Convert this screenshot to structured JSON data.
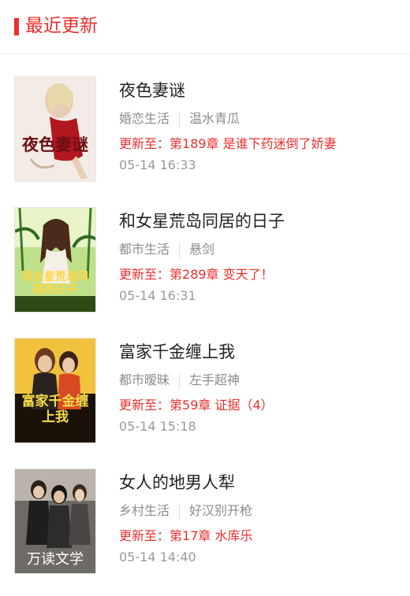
{
  "header": {
    "title": "最近更新"
  },
  "books": [
    {
      "title": "夜色妻谜",
      "category": "婚恋生活",
      "author": "温水青瓜",
      "update_prefix": "更新至：",
      "chapter": "第189章 是谁下药迷倒了娇妻",
      "time": "05-14 16:33",
      "cover_text": "夜色妻谜"
    },
    {
      "title": "和女星荒岛同居的日子",
      "category": "都市生活",
      "author": "悬剑",
      "update_prefix": "更新至：",
      "chapter": "第289章 变天了！",
      "time": "05-14 16:31",
      "cover_text": "和女星荒岛同居的日子"
    },
    {
      "title": "富家千金缠上我",
      "category": "都市暧昧",
      "author": "左手超神",
      "update_prefix": "更新至：",
      "chapter": "第59章 证据（4）",
      "time": "05-14 15:18",
      "cover_text": "富家千金缠上我"
    },
    {
      "title": "女人的地男人犁",
      "category": "乡村生活",
      "author": "好汉别开枪",
      "update_prefix": "更新至：",
      "chapter": "第17章 水库乐",
      "time": "05-14 14:40",
      "cover_text": "万读文学"
    }
  ]
}
